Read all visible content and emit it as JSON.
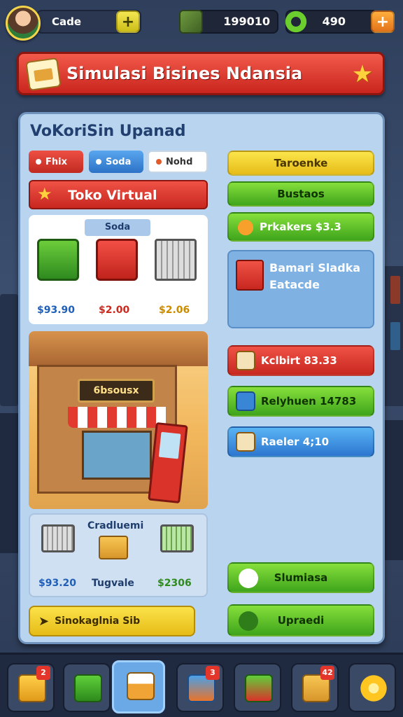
{
  "hud": {
    "player_name": "Cade",
    "money": "199010",
    "gear": "490"
  },
  "banner": {
    "title": "Simulasi Bisines Ndansia"
  },
  "panel": {
    "title": "VoKoriSin Upanad",
    "chips": [
      {
        "label": "Fhix",
        "color": "#ee4f43"
      },
      {
        "label": "Soda",
        "color": "#2d72c7"
      },
      {
        "label": "Nohd",
        "color": "#ffffff"
      }
    ],
    "store_title": "Toko Virtual",
    "sale_tab": "Soda",
    "product_prices": [
      "$93.90",
      "$2.00",
      "$2.06"
    ],
    "shop_sign": "6bsousx",
    "summary": {
      "title": "Cradluemi",
      "left_value": "$93.20",
      "right_label": "Tugvale",
      "right_value": "$2306"
    },
    "long_button": "Sinokaglnia Sib"
  },
  "right_column": {
    "btn_yellow": "Taroenke",
    "btn_green": "Bustaos",
    "btn_produce": "Prkakers $3.3",
    "info_line1": "Bamari Sladka",
    "info_line2": "Eatacde",
    "btn_red": "Kclbirt 83.33",
    "btn_green2": "Relyhuen 14783",
    "btn_blue": "Raeler 4;10",
    "btn_green3": "Slumiasa",
    "btn_green4": "Upraedi"
  },
  "bottom_nav": {
    "badges": [
      "2",
      "3",
      "42"
    ]
  },
  "colors": {
    "accent_red": "#d9332a",
    "accent_green": "#3fa51c",
    "accent_yellow": "#e6bc17",
    "accent_blue": "#2c76d0",
    "panel": "#b9d4ee"
  }
}
